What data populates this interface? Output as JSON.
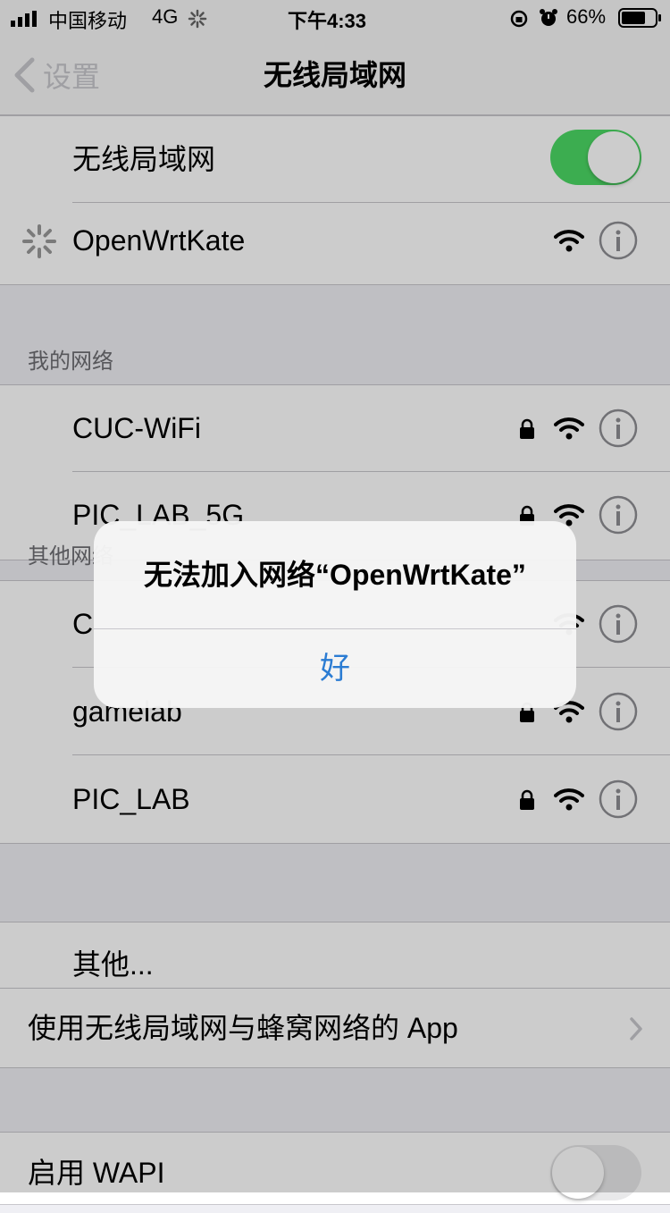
{
  "status_bar": {
    "carrier": "中国移动",
    "network": "4G",
    "time": "下午4:33",
    "battery": "66%"
  },
  "nav": {
    "back_label": "设置",
    "title": "无线局域网"
  },
  "wifi_toggle": {
    "label": "无线局域网",
    "on": true
  },
  "current_network": {
    "name": "OpenWrtKate"
  },
  "my_networks": {
    "header": "我的网络",
    "items": [
      {
        "name": "CUC-WiFi"
      },
      {
        "name": "PIC_LAB_5G"
      }
    ]
  },
  "other_networks": {
    "header": "其他网络",
    "items": [
      {
        "name": "C"
      },
      {
        "name": "gamelab"
      },
      {
        "name": "PIC_LAB"
      }
    ]
  },
  "other_row": {
    "label": "其他..."
  },
  "apps_row": {
    "label": "使用无线局域网与蜂窝网络的 App"
  },
  "wapi_row": {
    "label": "启用 WAPI",
    "on": false
  },
  "alert": {
    "title": "无法加入网络“OpenWrtKate”",
    "ok_label": "好"
  },
  "colors": {
    "toggle_on": "#4cd964",
    "link_blue": "#2b7cd3"
  }
}
